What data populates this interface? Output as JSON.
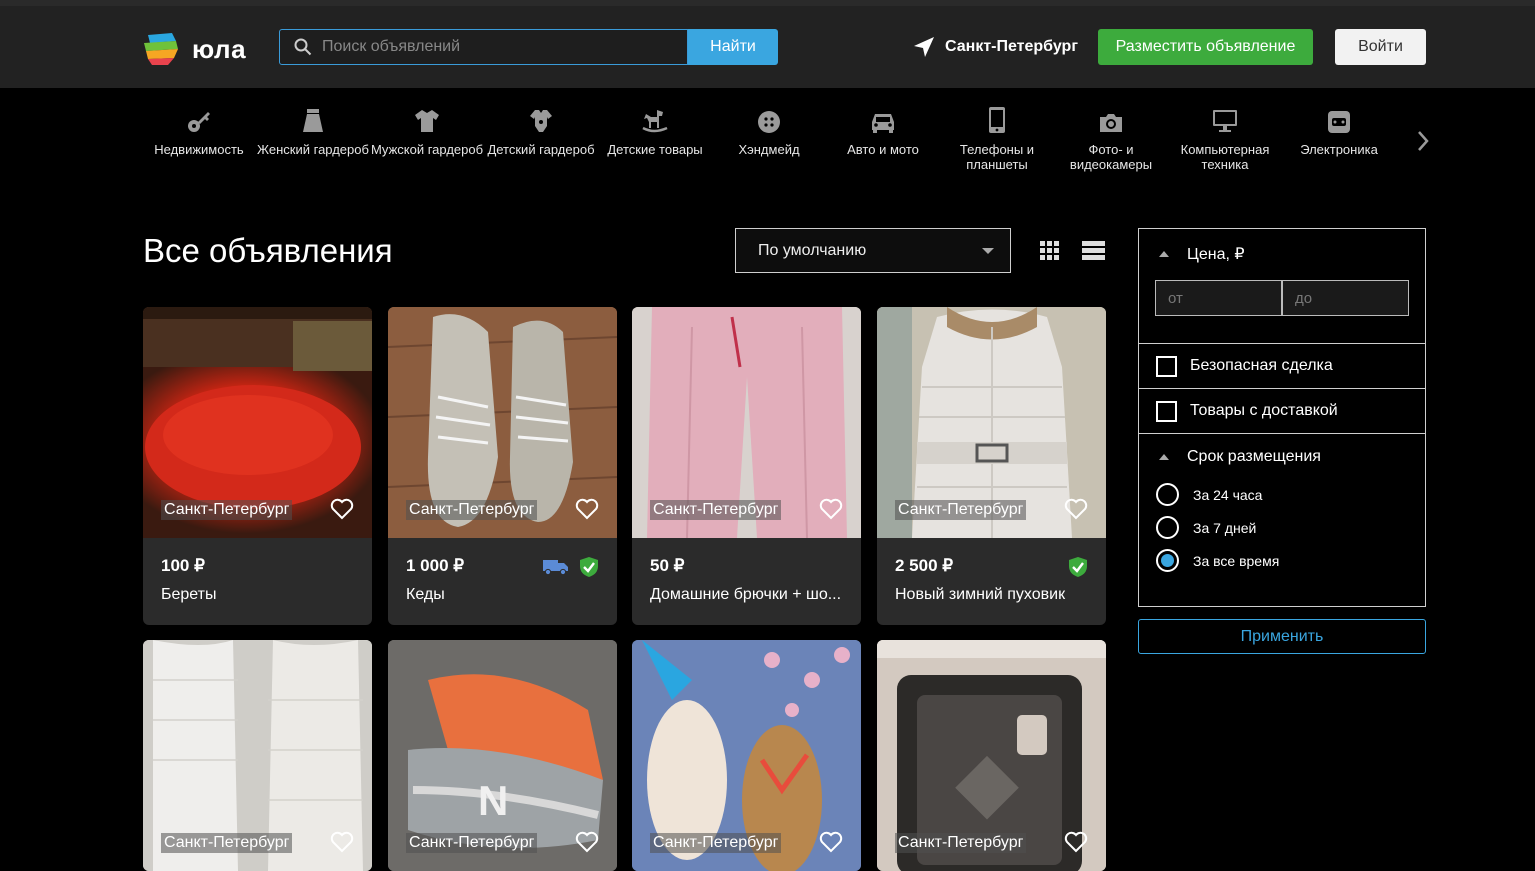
{
  "header": {
    "logo_text": "юла",
    "search_placeholder": "Поиск объявлений",
    "search_button": "Найти",
    "city": "Санкт-Петербург",
    "post_button": "Разместить объявление",
    "login_button": "Войти"
  },
  "categories": [
    {
      "label": "Недвижимость",
      "icon": "key-icon"
    },
    {
      "label": "Женский гардероб",
      "icon": "skirt-icon"
    },
    {
      "label": "Мужской гардероб",
      "icon": "shirt-icon"
    },
    {
      "label": "Детский гардероб",
      "icon": "bodysuit-icon"
    },
    {
      "label": "Детские товары",
      "icon": "rocking-horse-icon"
    },
    {
      "label": "Хэндмейд",
      "icon": "button-icon"
    },
    {
      "label": "Авто и мото",
      "icon": "car-icon"
    },
    {
      "label": "Телефоны и планшеты",
      "icon": "phone-icon"
    },
    {
      "label": "Фото- и видеокамеры",
      "icon": "camera-icon"
    },
    {
      "label": "Компьютерная техника",
      "icon": "monitor-icon"
    },
    {
      "label": "Электроника",
      "icon": "radio-icon"
    }
  ],
  "main": {
    "title": "Все объявления",
    "sort_value": "По умолчанию"
  },
  "listings": [
    {
      "city": "Санкт-Петербург",
      "price": "100 ₽",
      "name": "Береты",
      "delivery": false,
      "safe": false
    },
    {
      "city": "Санкт-Петербург",
      "price": "1 000 ₽",
      "name": "Кеды",
      "delivery": true,
      "safe": true
    },
    {
      "city": "Санкт-Петербург",
      "price": "50 ₽",
      "name": "Домашние брючки + шо...",
      "delivery": false,
      "safe": false
    },
    {
      "city": "Санкт-Петербург",
      "price": "2 500 ₽",
      "name": "Новый зимний пуховик",
      "delivery": false,
      "safe": true
    },
    {
      "city": "Санкт-Петербург"
    },
    {
      "city": "Санкт-Петербург"
    },
    {
      "city": "Санкт-Петербург"
    },
    {
      "city": "Санкт-Петербург"
    }
  ],
  "filters": {
    "price_title": "Цена, ₽",
    "price_from_placeholder": "от",
    "price_to_placeholder": "до",
    "safe_deal": "Безопасная сделка",
    "with_delivery": "Товары с доставкой",
    "period_title": "Срок размещения",
    "period_options": [
      "За 24 часа",
      "За 7 дней",
      "За все время"
    ],
    "period_selected": "За все время",
    "apply_button": "Применить"
  },
  "colors": {
    "accent_blue": "#3aa6e0",
    "post_green": "#3dab3d",
    "header_bg": "#222222"
  }
}
